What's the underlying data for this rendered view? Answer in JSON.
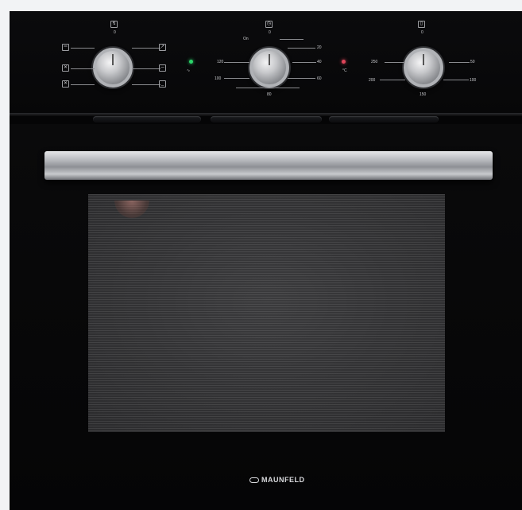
{
  "product": {
    "brand": "MAUNFELD"
  },
  "control_panel": {
    "left_dial": {
      "top_label": "0",
      "icons": [
        "top-heat-icon",
        "grill-icon",
        "fan-icon",
        "light-icon",
        "convection-icon",
        "bottom-heat-icon"
      ]
    },
    "center_dial": {
      "top_label": "0",
      "on_label": "On",
      "scale": [
        "20",
        "40",
        "60",
        "80",
        "100",
        "120"
      ]
    },
    "right_dial": {
      "top_label": "0",
      "scale": [
        "50",
        "100",
        "150",
        "200",
        "250"
      ]
    },
    "indicators": {
      "power_color": "#2bd46a",
      "heat_color": "#e0455a",
      "heat_symbol": "°C"
    }
  }
}
